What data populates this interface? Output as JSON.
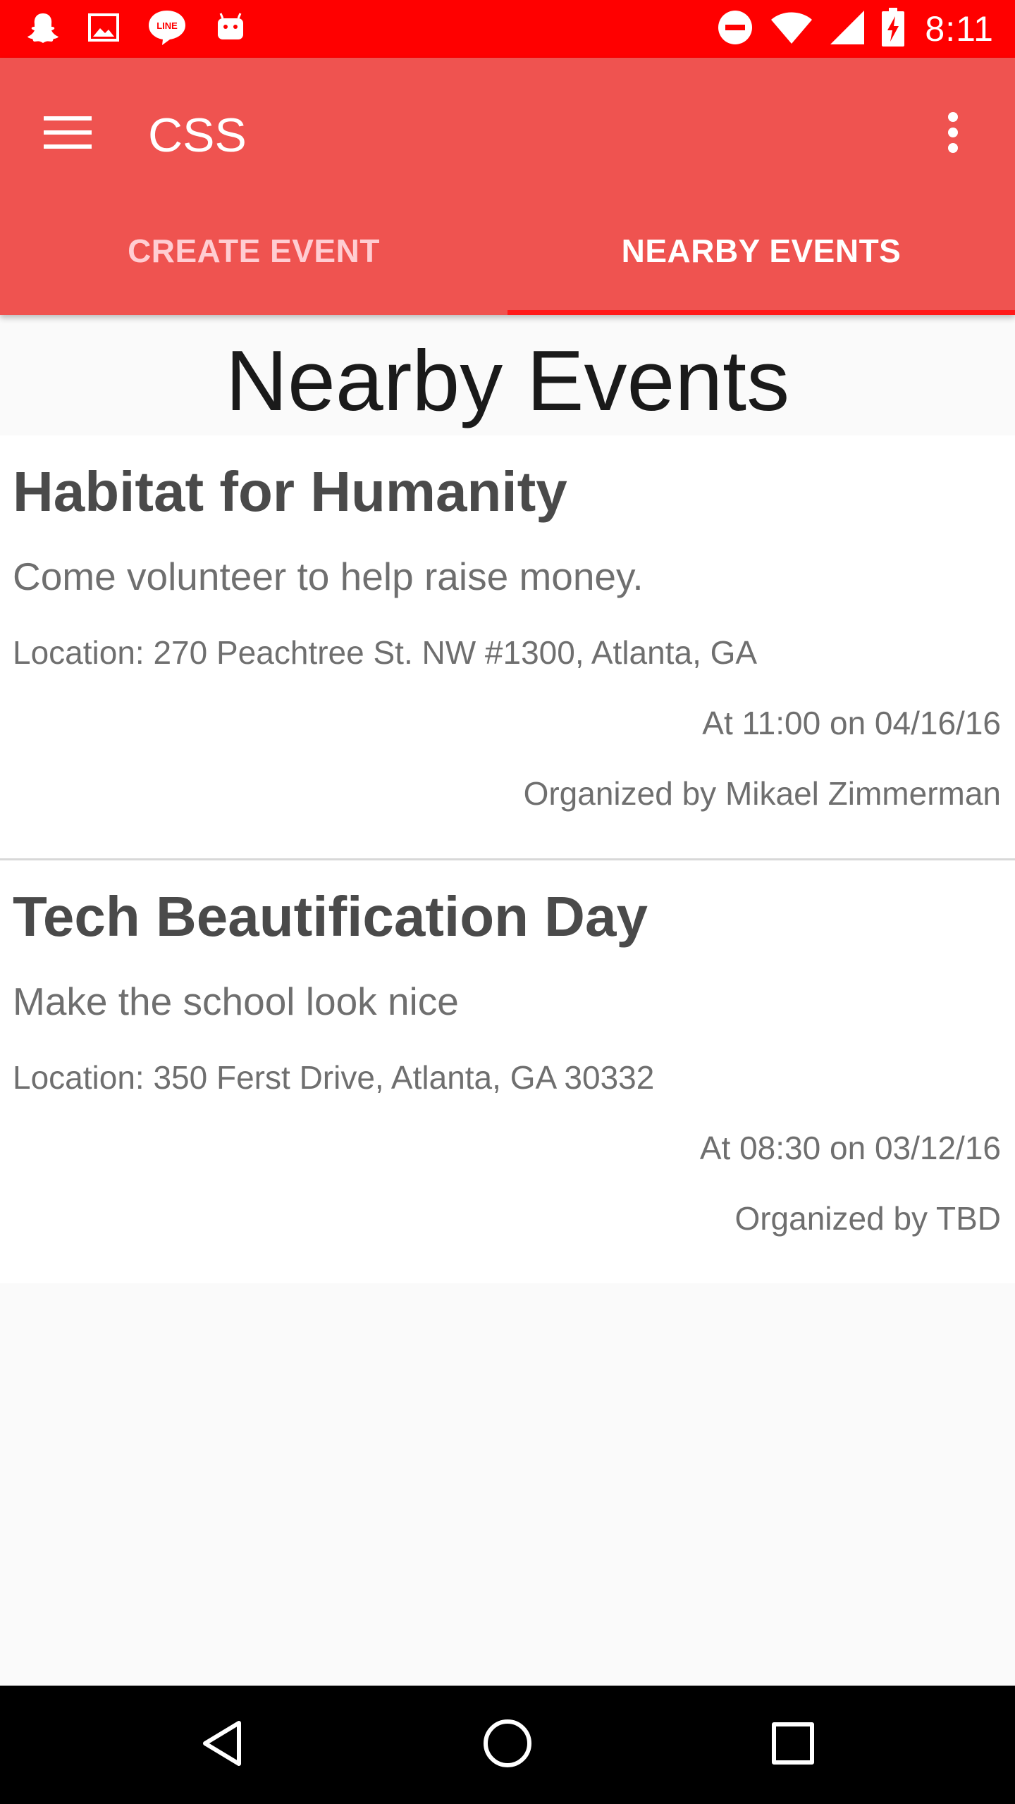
{
  "status_bar": {
    "time": "8:11",
    "notification_icons": [
      "snapchat-icon",
      "image-icon",
      "line-icon",
      "android-icon"
    ],
    "status_icons": [
      "do-not-disturb-icon",
      "wifi-icon",
      "cell-signal-icon",
      "battery-charging-icon"
    ],
    "background_color": "#ff0000"
  },
  "app_bar": {
    "title": "CSS",
    "background_color": "#ef5350",
    "menu_icon": "hamburger-menu-icon",
    "overflow_icon": "more-vert-icon"
  },
  "tabs": [
    {
      "label": "CREATE EVENT",
      "active": false
    },
    {
      "label": "NEARBY EVENTS",
      "active": true
    }
  ],
  "page": {
    "heading": "Nearby Events"
  },
  "events": [
    {
      "title": "Habitat for Humanity",
      "description": "Come volunteer to help raise money.",
      "location": "Location: 270 Peachtree St. NW #1300, Atlanta, GA",
      "time": "At 11:00 on 04/16/16",
      "organizer": "Organized by Mikael Zimmerman"
    },
    {
      "title": "Tech Beautification Day",
      "description": "Make the school look nice",
      "location": "Location: 350 Ferst Drive, Atlanta, GA 30332",
      "time": "At 08:30 on 03/12/16",
      "organizer": "Organized by TBD"
    }
  ],
  "nav_bar": {
    "buttons": [
      "back-icon",
      "home-icon",
      "recents-icon"
    ]
  }
}
